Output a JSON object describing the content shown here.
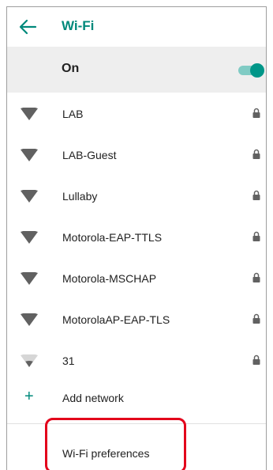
{
  "header": {
    "title": "Wi-Fi",
    "back_icon": "arrow-left-icon"
  },
  "toggle": {
    "label": "On",
    "state": "on",
    "accent": "#009688"
  },
  "networks": [
    {
      "name": "LAB",
      "signal": "full",
      "secured": true
    },
    {
      "name": "LAB-Guest",
      "signal": "full",
      "secured": true
    },
    {
      "name": "Lullaby",
      "signal": "full",
      "secured": true
    },
    {
      "name": "Motorola-EAP-TTLS",
      "signal": "full",
      "secured": true
    },
    {
      "name": "Motorola-MSCHAP",
      "signal": "full",
      "secured": true
    },
    {
      "name": "MotorolaAP-EAP-TLS",
      "signal": "full",
      "secured": true
    },
    {
      "name": "31",
      "signal": "weak",
      "secured": true
    }
  ],
  "add_network": {
    "label": "Add network",
    "icon": "plus-icon"
  },
  "preferences": {
    "label": "Wi-Fi preferences"
  },
  "colors": {
    "accent": "#00897b",
    "highlight": "#e3001b",
    "icon_gray": "#616161"
  }
}
